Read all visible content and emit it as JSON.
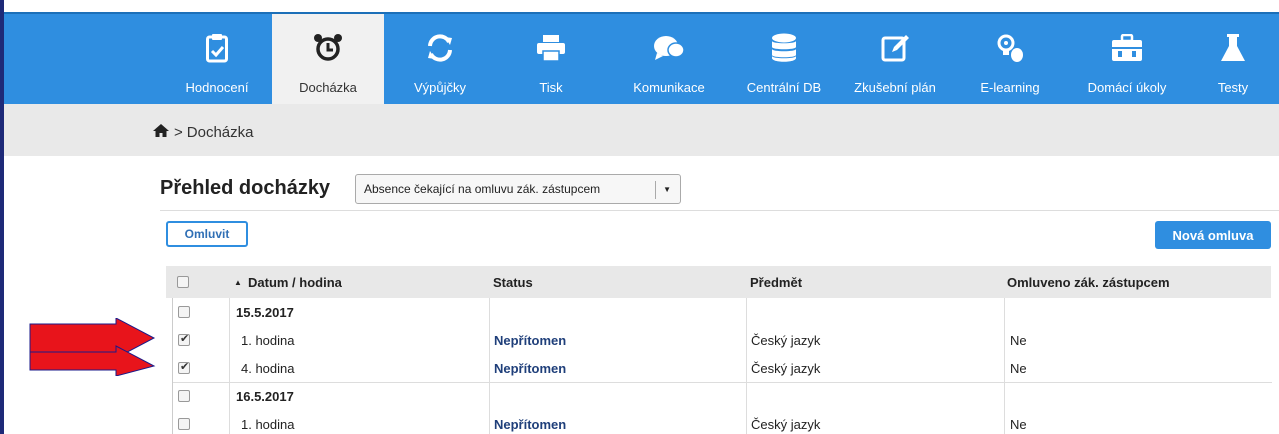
{
  "nav": {
    "items": [
      {
        "label": "Hodnocení",
        "icon": "clipboard-check-icon",
        "active": false
      },
      {
        "label": "Docházka",
        "icon": "alarm-clock-icon",
        "active": true
      },
      {
        "label": "Výpůjčky",
        "icon": "refresh-icon",
        "active": false
      },
      {
        "label": "Tisk",
        "icon": "printer-icon",
        "active": false
      },
      {
        "label": "Komunikace",
        "icon": "chat-bubbles-icon",
        "active": false
      },
      {
        "label": "Centrální DB",
        "icon": "database-icon",
        "active": false
      },
      {
        "label": "Zkušební plán",
        "icon": "edit-icon",
        "active": false
      },
      {
        "label": "E-learning",
        "icon": "mouse-bulb-icon",
        "active": false
      },
      {
        "label": "Domácí úkoly",
        "icon": "briefcase-icon",
        "active": false
      },
      {
        "label": "Testy",
        "icon": "flask-icon",
        "active": false
      }
    ]
  },
  "breadcrumb": {
    "separator": ">",
    "current": "Docházka"
  },
  "page": {
    "title": "Přehled docházky",
    "filter_value": "Absence čekající na omluvu zák. zástupcem",
    "omluvit_label": "Omluvit",
    "nova_omluva_label": "Nová omluva"
  },
  "table": {
    "headers": {
      "date": "Datum / hodina",
      "status": "Status",
      "subject": "Předmět",
      "excused": "Omluveno zák. zástupcem"
    },
    "sort_indicator": "▲",
    "groups": [
      {
        "date": "15.5.2017",
        "rows": [
          {
            "hour": "1. hodina",
            "status": "Nepřítomen",
            "subject": "Český jazyk",
            "excused": "Ne",
            "checked": true
          },
          {
            "hour": "4. hodina",
            "status": "Nepřítomen",
            "subject": "Český jazyk",
            "excused": "Ne",
            "checked": true
          }
        ]
      },
      {
        "date": "16.5.2017",
        "rows": [
          {
            "hour": "1. hodina",
            "status": "Nepřítomen",
            "subject": "Český jazyk",
            "excused": "Ne",
            "checked": false
          }
        ]
      }
    ]
  },
  "colors": {
    "accent": "#2f8ee0",
    "arrow": "#e8141b"
  }
}
